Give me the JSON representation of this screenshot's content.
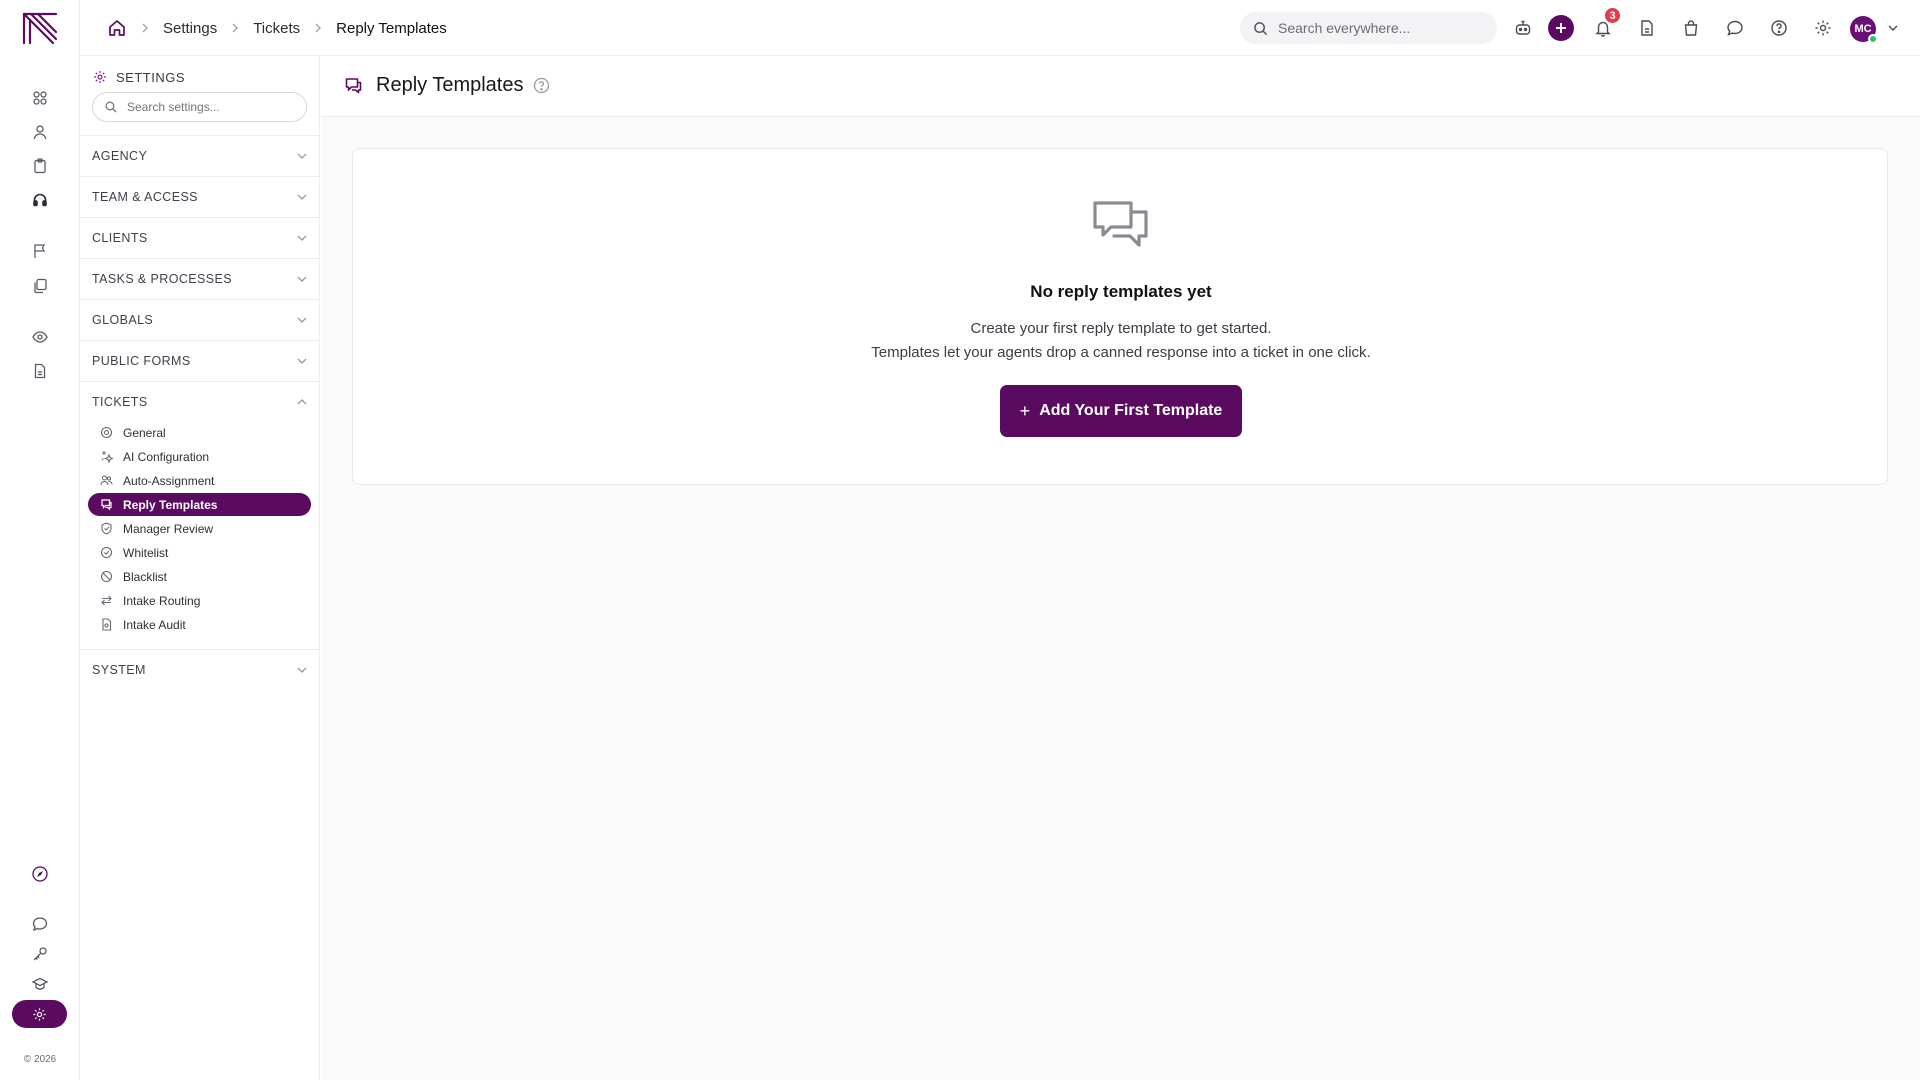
{
  "rail": {
    "icons": [
      "grid-icon",
      "user-icon",
      "clipboard-icon",
      "headset-icon",
      "flag-icon",
      "docs-stack-icon",
      "eye-icon",
      "document-icon"
    ],
    "bottom_icons": [
      "rocket-icon",
      "chat-icon",
      "key-icon",
      "graduation-cap-icon",
      "settings-gear-icon"
    ],
    "copyright": "© 2026"
  },
  "topbar": {
    "breadcrumbs": [
      "Settings",
      "Tickets",
      "Reply Templates"
    ],
    "search_placeholder": "Search everywhere...",
    "notification_count": "3",
    "avatar_initials": "MC"
  },
  "settings_panel": {
    "title": "SETTINGS",
    "search_placeholder": "Search settings...",
    "sections": [
      {
        "label": "AGENCY",
        "expanded": false
      },
      {
        "label": "TEAM & ACCESS",
        "expanded": false
      },
      {
        "label": "CLIENTS",
        "expanded": false
      },
      {
        "label": "TASKS & PROCESSES",
        "expanded": false
      },
      {
        "label": "GLOBALS",
        "expanded": false
      },
      {
        "label": "PUBLIC FORMS",
        "expanded": false
      },
      {
        "label": "TICKETS",
        "expanded": true
      },
      {
        "label": "SYSTEM",
        "expanded": false
      }
    ],
    "ticket_items": [
      {
        "label": "General",
        "icon": "gear-icon"
      },
      {
        "label": "AI Configuration",
        "icon": "sparkles-icon"
      },
      {
        "label": "Auto-Assignment",
        "icon": "users-icon"
      },
      {
        "label": "Reply Templates",
        "icon": "chat-bubbles-icon",
        "active": true
      },
      {
        "label": "Manager Review",
        "icon": "shield-check-icon"
      },
      {
        "label": "Whitelist",
        "icon": "check-circle-icon"
      },
      {
        "label": "Blacklist",
        "icon": "ban-icon"
      },
      {
        "label": "Intake Routing",
        "icon": "arrows-icon"
      },
      {
        "label": "Intake Audit",
        "icon": "file-audit-icon"
      }
    ]
  },
  "main": {
    "title": "Reply Templates",
    "empty_state": {
      "title": "No reply templates yet",
      "line1": "Create your first reply template to get started.",
      "line2": "Templates let your agents drop a canned response into a ticket in one click.",
      "button_label": "Add Your First Template"
    }
  },
  "colors": {
    "brand": "#5b0b5f",
    "badge": "#e23b4a",
    "online": "#22c55e"
  }
}
